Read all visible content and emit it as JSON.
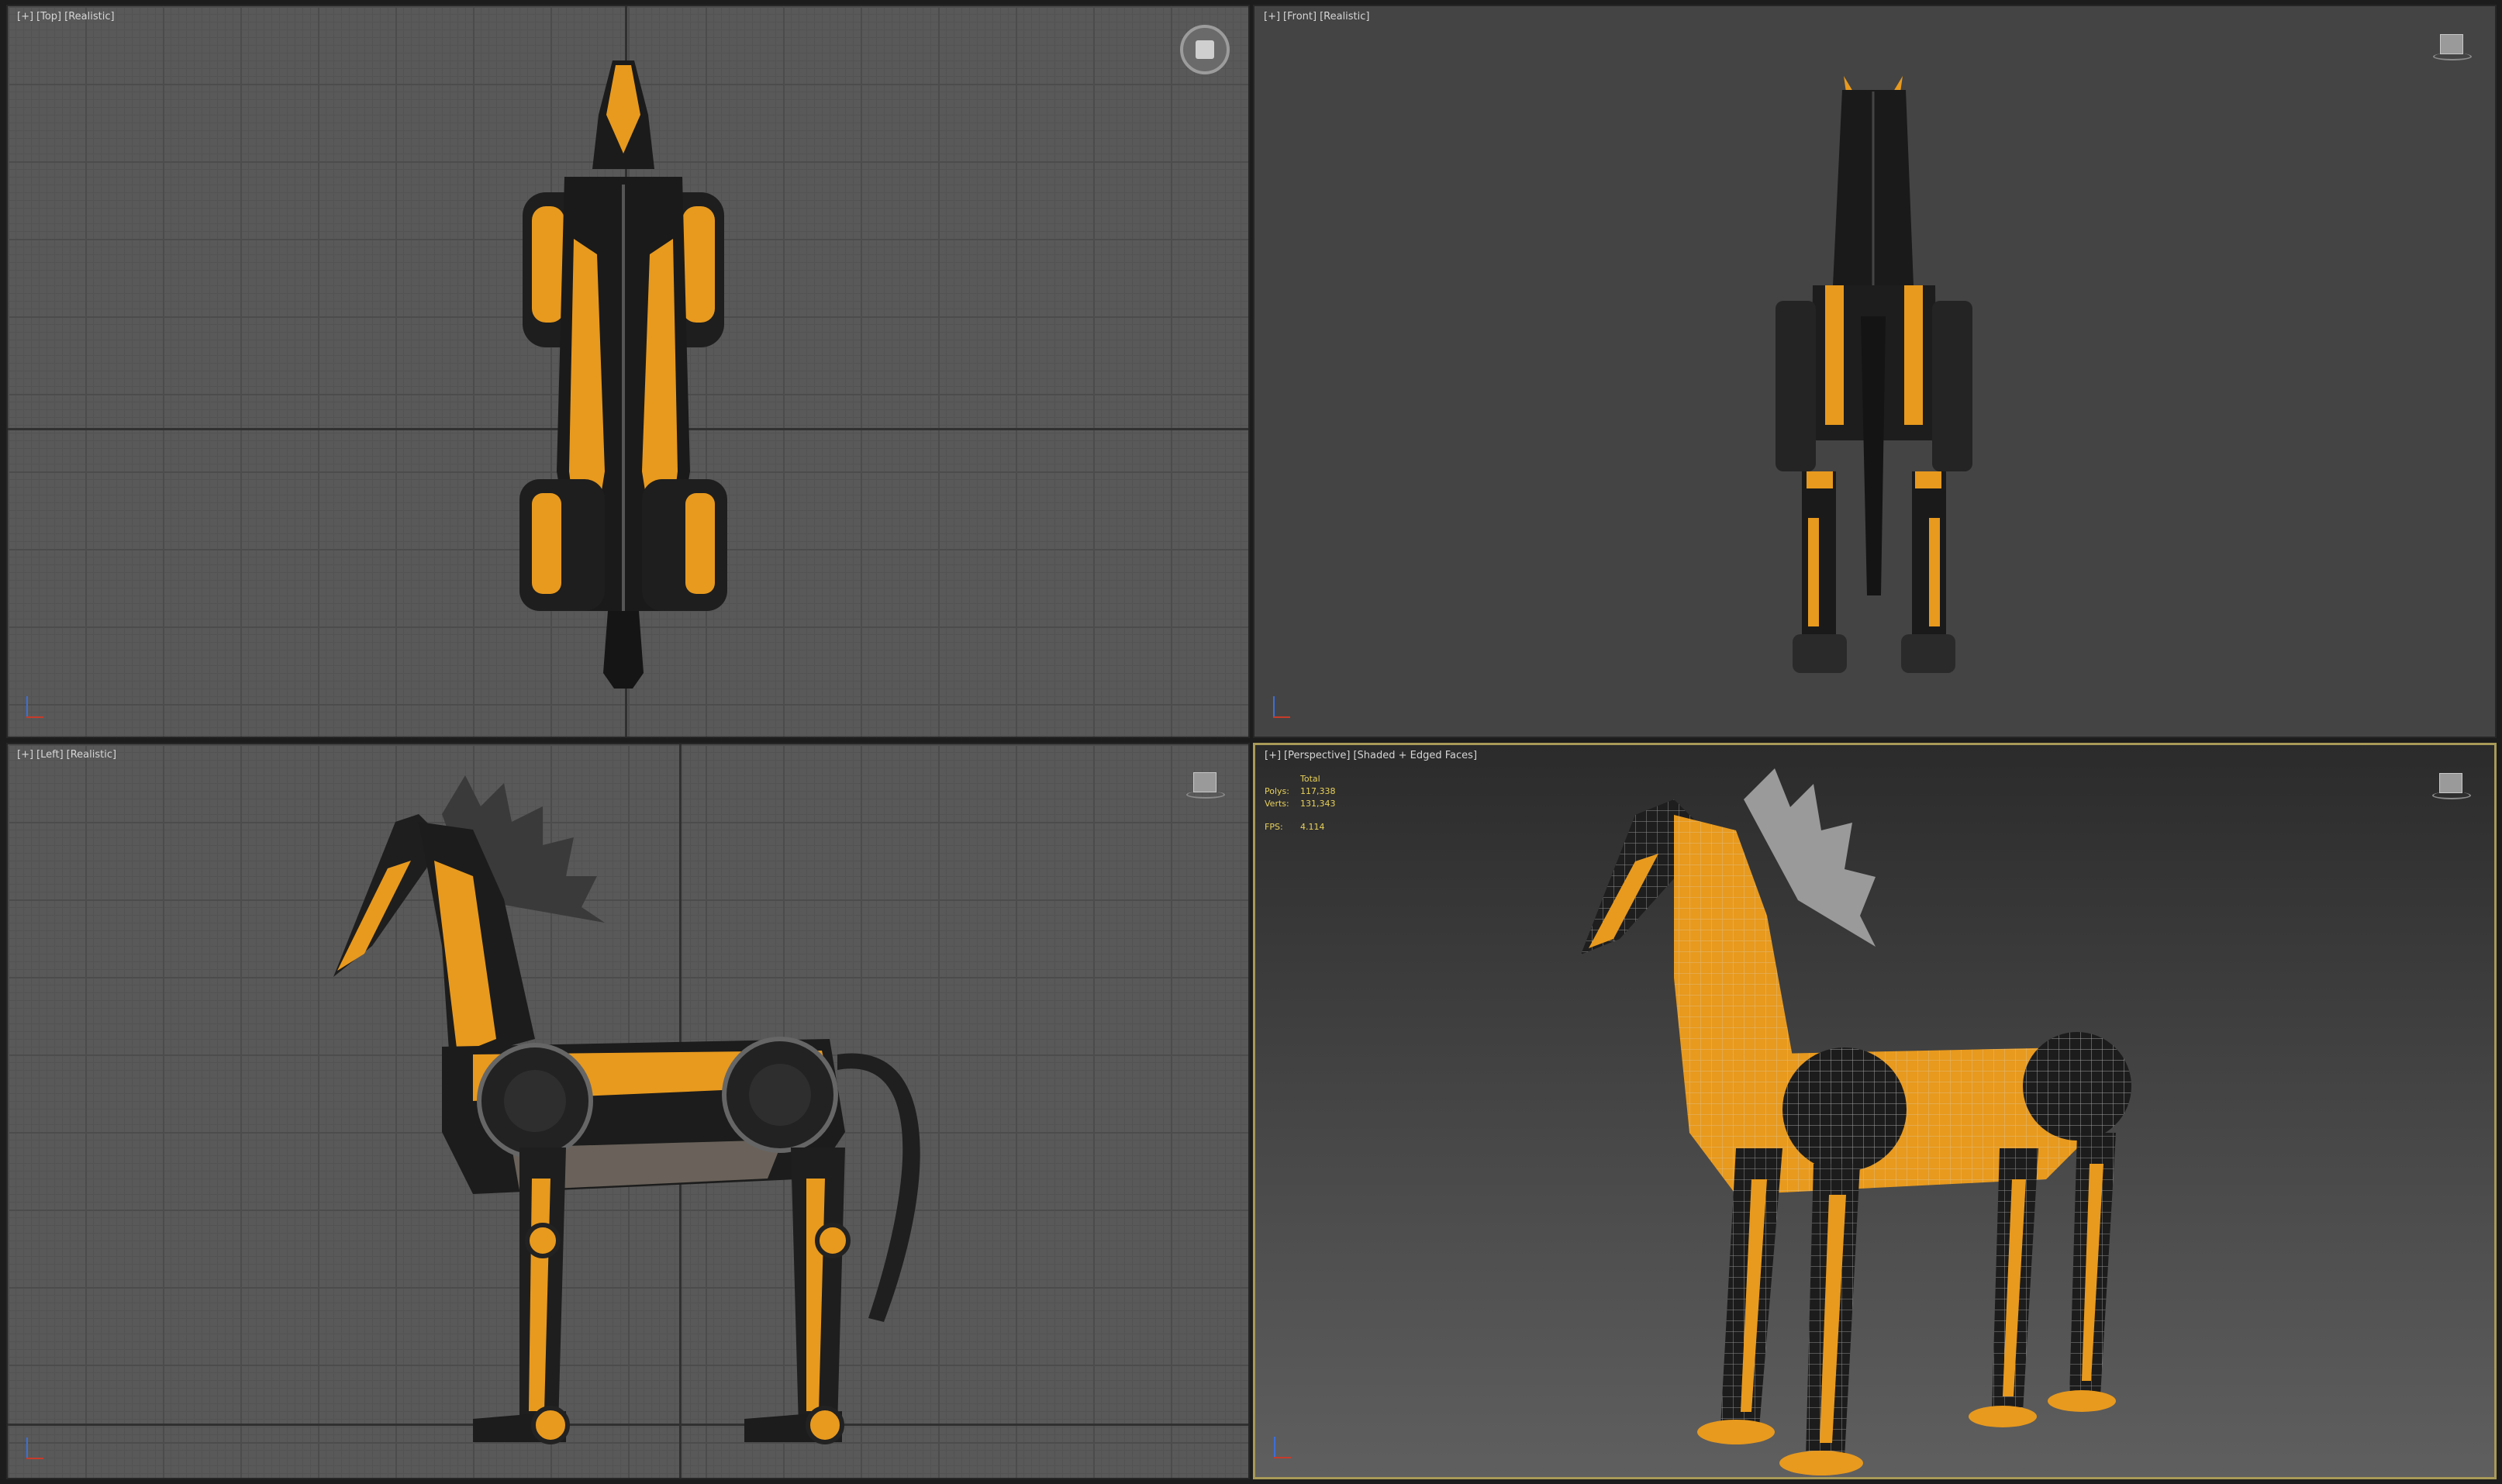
{
  "viewports": {
    "top": {
      "labels": [
        "[+]",
        "[Top]",
        "[Realistic]"
      ]
    },
    "front": {
      "labels": [
        "[+]",
        "[Front]",
        "[Realistic]"
      ]
    },
    "left": {
      "labels": [
        "[+]",
        "[Left]",
        "[Realistic]"
      ]
    },
    "perspective": {
      "labels": [
        "[+]",
        "[Perspective]",
        "[Shaded + Edged Faces]"
      ],
      "stats": {
        "header": "Total",
        "polys_label": "Polys:",
        "polys_value": "117,338",
        "verts_label": "Verts:",
        "verts_value": "131,343",
        "fps_label": "FPS:",
        "fps_value": "4.114"
      }
    }
  },
  "colors": {
    "accent_orange": "#e89a1e",
    "body_black": "#1b1b1b",
    "active_border": "#a89a58",
    "stats_text": "#e8d15a"
  },
  "icons": {
    "nav_wheel": "steering-wheel-icon",
    "viewcube": "viewcube-icon",
    "axis": "axis-tripod-icon"
  }
}
